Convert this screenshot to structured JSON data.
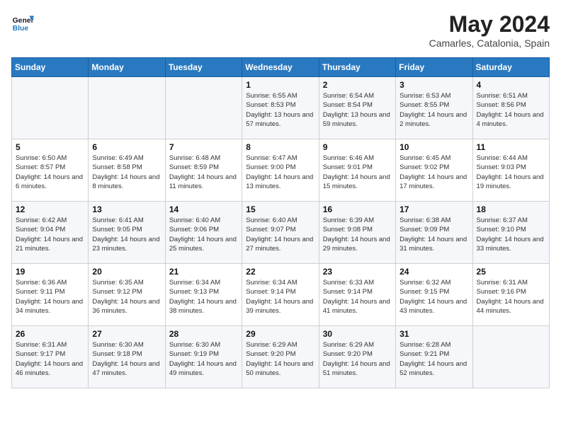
{
  "header": {
    "logo_line1": "General",
    "logo_line2": "Blue",
    "month": "May 2024",
    "location": "Camarles, Catalonia, Spain"
  },
  "days_of_week": [
    "Sunday",
    "Monday",
    "Tuesday",
    "Wednesday",
    "Thursday",
    "Friday",
    "Saturday"
  ],
  "weeks": [
    [
      {
        "day": "",
        "info": ""
      },
      {
        "day": "",
        "info": ""
      },
      {
        "day": "",
        "info": ""
      },
      {
        "day": "1",
        "info": "Sunrise: 6:55 AM\nSunset: 8:53 PM\nDaylight: 13 hours and 57 minutes."
      },
      {
        "day": "2",
        "info": "Sunrise: 6:54 AM\nSunset: 8:54 PM\nDaylight: 13 hours and 59 minutes."
      },
      {
        "day": "3",
        "info": "Sunrise: 6:53 AM\nSunset: 8:55 PM\nDaylight: 14 hours and 2 minutes."
      },
      {
        "day": "4",
        "info": "Sunrise: 6:51 AM\nSunset: 8:56 PM\nDaylight: 14 hours and 4 minutes."
      }
    ],
    [
      {
        "day": "5",
        "info": "Sunrise: 6:50 AM\nSunset: 8:57 PM\nDaylight: 14 hours and 6 minutes."
      },
      {
        "day": "6",
        "info": "Sunrise: 6:49 AM\nSunset: 8:58 PM\nDaylight: 14 hours and 8 minutes."
      },
      {
        "day": "7",
        "info": "Sunrise: 6:48 AM\nSunset: 8:59 PM\nDaylight: 14 hours and 11 minutes."
      },
      {
        "day": "8",
        "info": "Sunrise: 6:47 AM\nSunset: 9:00 PM\nDaylight: 14 hours and 13 minutes."
      },
      {
        "day": "9",
        "info": "Sunrise: 6:46 AM\nSunset: 9:01 PM\nDaylight: 14 hours and 15 minutes."
      },
      {
        "day": "10",
        "info": "Sunrise: 6:45 AM\nSunset: 9:02 PM\nDaylight: 14 hours and 17 minutes."
      },
      {
        "day": "11",
        "info": "Sunrise: 6:44 AM\nSunset: 9:03 PM\nDaylight: 14 hours and 19 minutes."
      }
    ],
    [
      {
        "day": "12",
        "info": "Sunrise: 6:42 AM\nSunset: 9:04 PM\nDaylight: 14 hours and 21 minutes."
      },
      {
        "day": "13",
        "info": "Sunrise: 6:41 AM\nSunset: 9:05 PM\nDaylight: 14 hours and 23 minutes."
      },
      {
        "day": "14",
        "info": "Sunrise: 6:40 AM\nSunset: 9:06 PM\nDaylight: 14 hours and 25 minutes."
      },
      {
        "day": "15",
        "info": "Sunrise: 6:40 AM\nSunset: 9:07 PM\nDaylight: 14 hours and 27 minutes."
      },
      {
        "day": "16",
        "info": "Sunrise: 6:39 AM\nSunset: 9:08 PM\nDaylight: 14 hours and 29 minutes."
      },
      {
        "day": "17",
        "info": "Sunrise: 6:38 AM\nSunset: 9:09 PM\nDaylight: 14 hours and 31 minutes."
      },
      {
        "day": "18",
        "info": "Sunrise: 6:37 AM\nSunset: 9:10 PM\nDaylight: 14 hours and 33 minutes."
      }
    ],
    [
      {
        "day": "19",
        "info": "Sunrise: 6:36 AM\nSunset: 9:11 PM\nDaylight: 14 hours and 34 minutes."
      },
      {
        "day": "20",
        "info": "Sunrise: 6:35 AM\nSunset: 9:12 PM\nDaylight: 14 hours and 36 minutes."
      },
      {
        "day": "21",
        "info": "Sunrise: 6:34 AM\nSunset: 9:13 PM\nDaylight: 14 hours and 38 minutes."
      },
      {
        "day": "22",
        "info": "Sunrise: 6:34 AM\nSunset: 9:14 PM\nDaylight: 14 hours and 39 minutes."
      },
      {
        "day": "23",
        "info": "Sunrise: 6:33 AM\nSunset: 9:14 PM\nDaylight: 14 hours and 41 minutes."
      },
      {
        "day": "24",
        "info": "Sunrise: 6:32 AM\nSunset: 9:15 PM\nDaylight: 14 hours and 43 minutes."
      },
      {
        "day": "25",
        "info": "Sunrise: 6:31 AM\nSunset: 9:16 PM\nDaylight: 14 hours and 44 minutes."
      }
    ],
    [
      {
        "day": "26",
        "info": "Sunrise: 6:31 AM\nSunset: 9:17 PM\nDaylight: 14 hours and 46 minutes."
      },
      {
        "day": "27",
        "info": "Sunrise: 6:30 AM\nSunset: 9:18 PM\nDaylight: 14 hours and 47 minutes."
      },
      {
        "day": "28",
        "info": "Sunrise: 6:30 AM\nSunset: 9:19 PM\nDaylight: 14 hours and 49 minutes."
      },
      {
        "day": "29",
        "info": "Sunrise: 6:29 AM\nSunset: 9:20 PM\nDaylight: 14 hours and 50 minutes."
      },
      {
        "day": "30",
        "info": "Sunrise: 6:29 AM\nSunset: 9:20 PM\nDaylight: 14 hours and 51 minutes."
      },
      {
        "day": "31",
        "info": "Sunrise: 6:28 AM\nSunset: 9:21 PM\nDaylight: 14 hours and 52 minutes."
      },
      {
        "day": "",
        "info": ""
      }
    ]
  ]
}
